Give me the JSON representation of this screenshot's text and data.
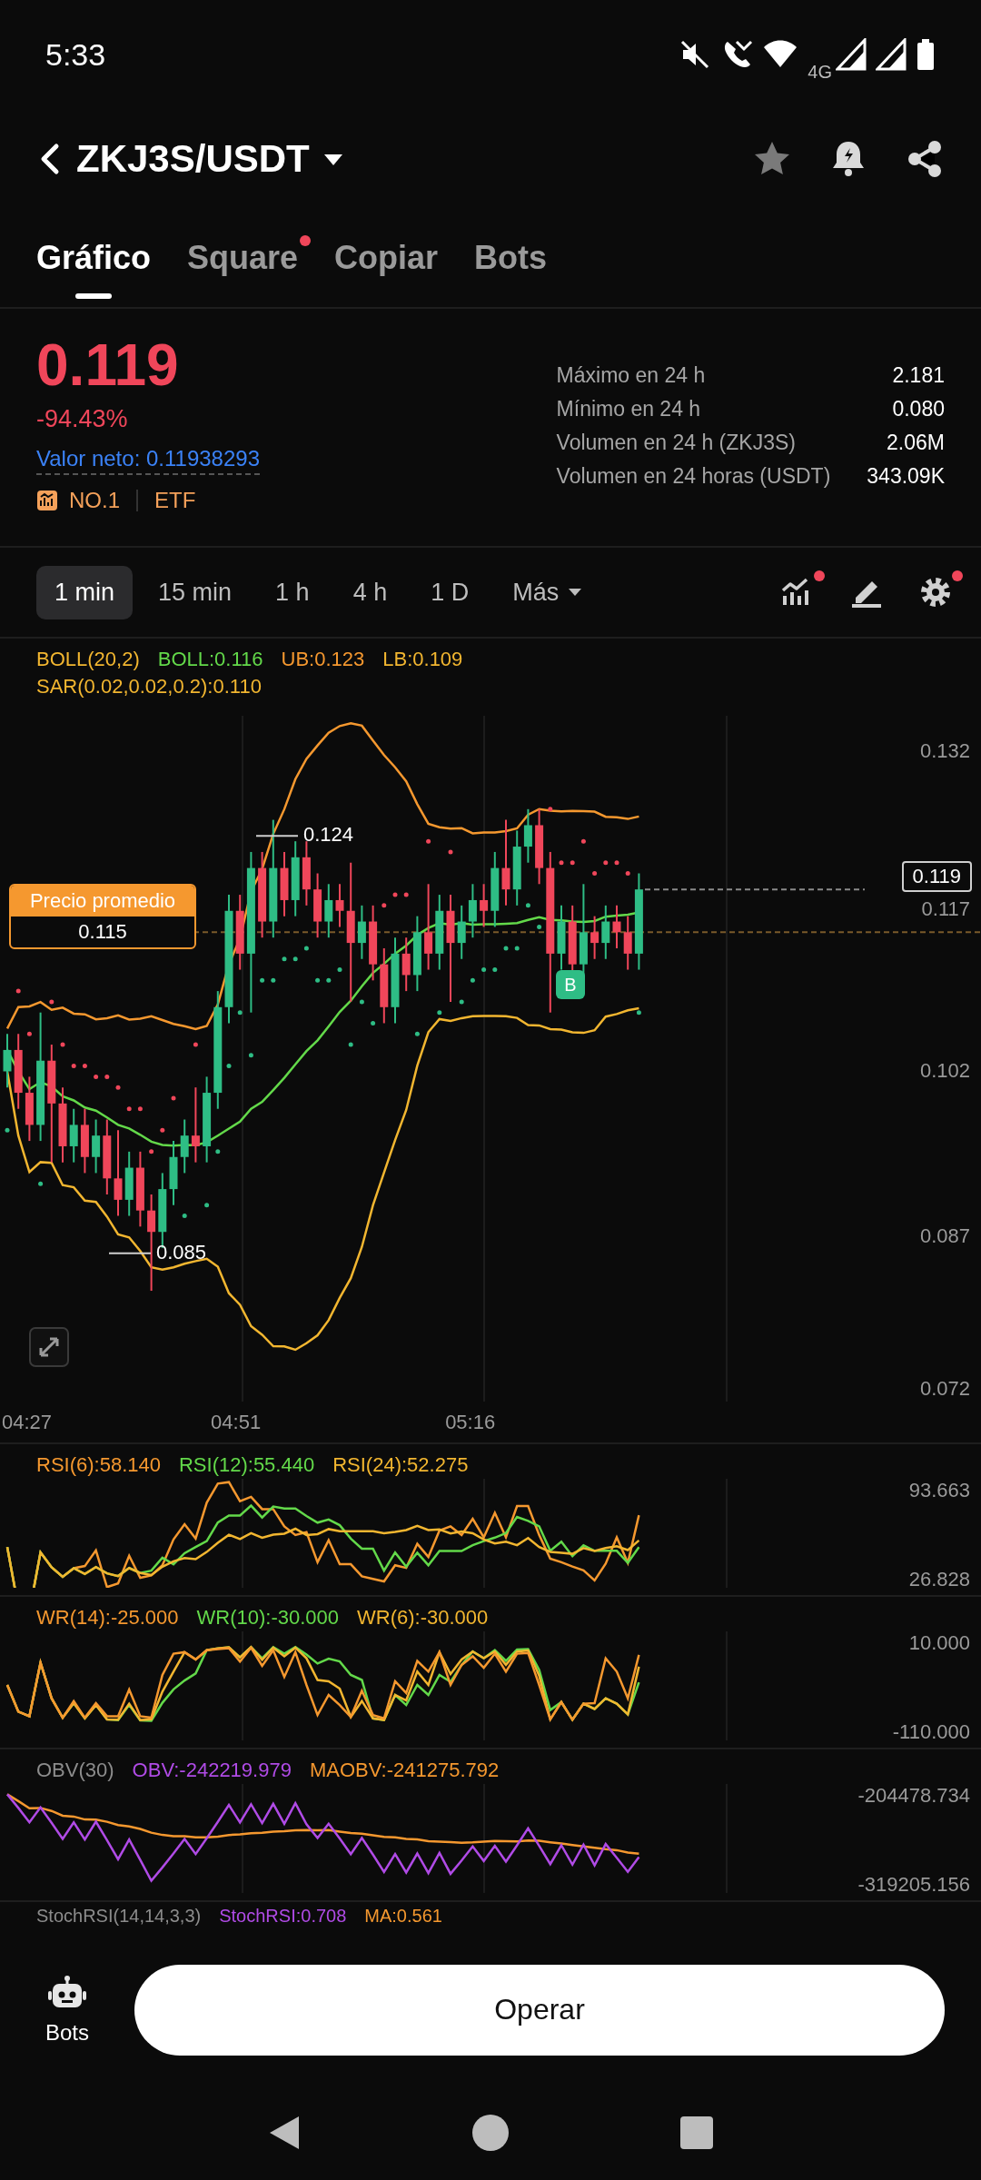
{
  "status_bar": {
    "time": "5:33",
    "network": "4G"
  },
  "header": {
    "pair": "ZKJ3S/USDT"
  },
  "tabs": [
    {
      "label": "Gráfico",
      "selected": true,
      "notification": false
    },
    {
      "label": "Square",
      "selected": false,
      "notification": true
    },
    {
      "label": "Copiar",
      "selected": false,
      "notification": false
    },
    {
      "label": "Bots",
      "selected": false,
      "notification": false
    }
  ],
  "ticker": {
    "price": "0.119",
    "change": "-94.43%",
    "net_value": "Valor neto: 0.11938293",
    "tags": [
      "NO.1",
      "ETF"
    ],
    "stats": [
      {
        "label": "Máximo en 24 h",
        "value": "2.181"
      },
      {
        "label": "Mínimo en 24 h",
        "value": "0.080"
      },
      {
        "label": "Volumen en 24 h (ZKJ3S)",
        "value": "2.06M"
      },
      {
        "label": "Volumen en 24 horas (USDT)",
        "value": "343.09K"
      }
    ]
  },
  "intervals": [
    {
      "label": "1 min",
      "selected": true,
      "dropdown": false
    },
    {
      "label": "15 min",
      "selected": false,
      "dropdown": false
    },
    {
      "label": "1 h",
      "selected": false,
      "dropdown": false
    },
    {
      "label": "4 h",
      "selected": false,
      "dropdown": false
    },
    {
      "label": "1 D",
      "selected": false,
      "dropdown": false
    },
    {
      "label": "Más",
      "selected": false,
      "dropdown": true
    }
  ],
  "toolbar": [
    {
      "kind": "indicators",
      "notification": true
    },
    {
      "kind": "draw",
      "notification": false
    },
    {
      "kind": "settings",
      "notification": true
    }
  ],
  "main_chart": {
    "legend": [
      [
        {
          "text": "BOLL(20,2)",
          "color": "#f2b630"
        },
        {
          "text": "BOLL:0.116",
          "color": "#63d94a"
        },
        {
          "text": "UB:0.123",
          "color": "#f5982f"
        },
        {
          "text": "LB:0.109",
          "color": "#f2b630"
        }
      ],
      [
        {
          "text": "SAR(0.02,0.02,0.2):0.110",
          "color": "#f2b630"
        }
      ]
    ],
    "y_labels": [
      "0.132",
      "0.117",
      "0.102",
      "0.087",
      "0.072"
    ],
    "x_labels": [
      "04:27",
      "04:51",
      "05:16"
    ],
    "last_price": "0.119",
    "average_price": {
      "label": "Precio promedio",
      "value": "0.115"
    },
    "high_marker": "0.124",
    "low_marker": "0.085",
    "trade_marker": "B"
  },
  "indicators": [
    {
      "kind": "rsi",
      "legend": [
        {
          "text": "RSI(6):58.140",
          "color": "#f5982f"
        },
        {
          "text": "RSI(12):55.440",
          "color": "#63d94a"
        },
        {
          "text": "RSI(24):52.275",
          "color": "#f2b630"
        }
      ],
      "y_labels": [
        "93.663",
        "26.828"
      ]
    },
    {
      "kind": "wr",
      "legend": [
        {
          "text": "WR(14):-25.000",
          "color": "#f5982f"
        },
        {
          "text": "WR(10):-30.000",
          "color": "#63d94a"
        },
        {
          "text": "WR(6):-30.000",
          "color": "#f2b630"
        }
      ],
      "y_labels": [
        "10.000",
        "-110.000"
      ]
    },
    {
      "kind": "obv",
      "legend": [
        {
          "text": "OBV(30)",
          "color": "#8c8c8c"
        },
        {
          "text": "OBV:-242219.979",
          "color": "#b04be6"
        },
        {
          "text": "MAOBV:-241275.792",
          "color": "#f5982f"
        }
      ],
      "y_labels": [
        "-204478.734",
        "-319205.156"
      ]
    }
  ],
  "stoch_legend": [
    {
      "text": "StochRSI(14,14,3,3)",
      "color": "#8c8c8c"
    },
    {
      "text": "StochRSI:0.708",
      "color": "#b04be6"
    },
    {
      "text": "MA:0.561",
      "color": "#f5982f"
    }
  ],
  "bottom_bar": {
    "bots_label": "Bots",
    "trade_button": "Operar"
  }
}
